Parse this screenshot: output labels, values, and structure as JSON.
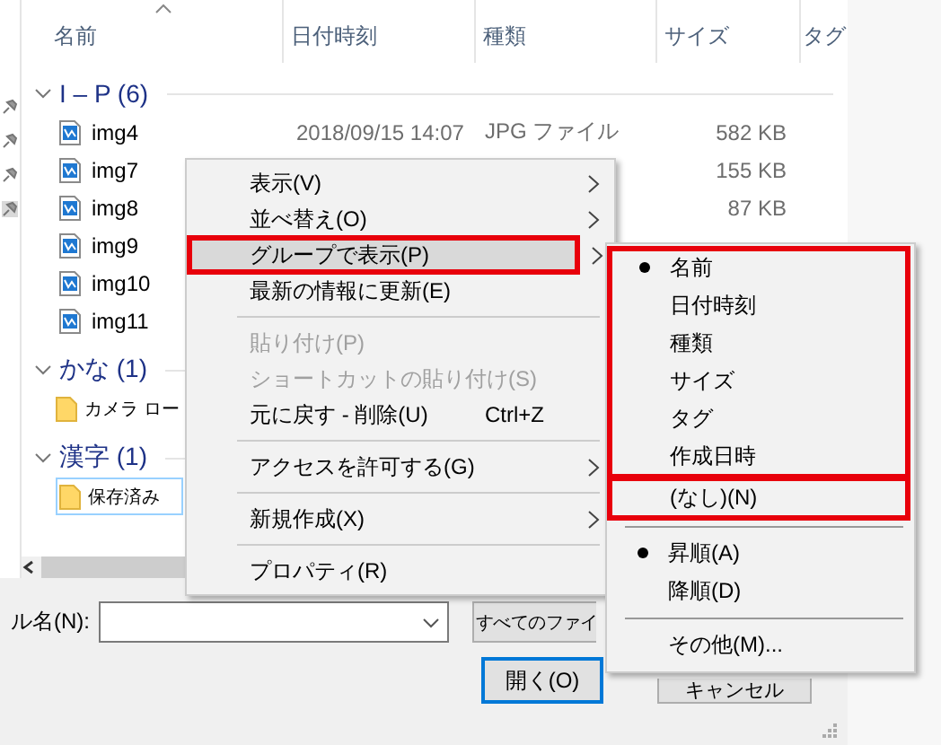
{
  "columns": [
    {
      "label": "名前",
      "sorted": true
    },
    {
      "label": "日付時刻",
      "sorted": false
    },
    {
      "label": "種類",
      "sorted": false
    },
    {
      "label": "サイズ",
      "sorted": false
    },
    {
      "label": "タグ",
      "sorted": false
    }
  ],
  "groups": [
    {
      "label": "I – P (6)",
      "expanded": true,
      "rows": [
        {
          "kind": "image",
          "name": "img4",
          "date": "2018/09/15 14:07",
          "type": "JPG ファイル",
          "size": "582 KB",
          "selected": false
        },
        {
          "kind": "image",
          "name": "img7",
          "size": "155 KB",
          "selected": false
        },
        {
          "kind": "image",
          "name": "img8",
          "size": "87 KB",
          "selected": false
        },
        {
          "kind": "image",
          "name": "img9",
          "selected": false
        },
        {
          "kind": "image",
          "name": "img10",
          "selected": false
        },
        {
          "kind": "image",
          "name": "img11",
          "selected": false
        }
      ]
    },
    {
      "label": "かな (1)",
      "expanded": true,
      "rows": [
        {
          "kind": "folder",
          "name": "カメラ ロー",
          "selected": false
        }
      ]
    },
    {
      "label": "漢字 (1)",
      "expanded": true,
      "rows": [
        {
          "kind": "folder",
          "name": "保存済み",
          "selected": true
        }
      ]
    }
  ],
  "file_name": {
    "label": "ル名(N):"
  },
  "file_type": {
    "value": "すべてのファイ"
  },
  "buttons": [
    {
      "label": "開く(O)",
      "default": true
    },
    {
      "label": "キャンセル",
      "default": false
    }
  ],
  "context_menu": [
    {
      "kind": "item",
      "label": "表示(V)",
      "submenu": true,
      "disabled": false,
      "selected": false,
      "outlined": false
    },
    {
      "kind": "item",
      "label": "並べ替え(O)",
      "submenu": true,
      "disabled": false,
      "selected": false,
      "outlined": false
    },
    {
      "kind": "item",
      "label": "グループで表示(P)",
      "submenu": true,
      "disabled": false,
      "selected": true,
      "outlined": true
    },
    {
      "kind": "item",
      "label": "最新の情報に更新(E)",
      "submenu": false,
      "disabled": false,
      "selected": false,
      "outlined": false
    },
    {
      "kind": "separator"
    },
    {
      "kind": "item",
      "label": "貼り付け(P)",
      "submenu": false,
      "disabled": true,
      "selected": false,
      "outlined": false
    },
    {
      "kind": "item",
      "label": "ショートカットの貼り付け(S)",
      "submenu": false,
      "disabled": true,
      "selected": false,
      "outlined": false
    },
    {
      "kind": "item",
      "label": "元に戻す - 削除(U)",
      "shortcut": "Ctrl+Z",
      "submenu": false,
      "disabled": false,
      "selected": false,
      "outlined": false
    },
    {
      "kind": "separator"
    },
    {
      "kind": "item",
      "label": "アクセスを許可する(G)",
      "submenu": true,
      "disabled": false,
      "selected": false,
      "outlined": false
    },
    {
      "kind": "separator"
    },
    {
      "kind": "item",
      "label": "新規作成(X)",
      "submenu": true,
      "disabled": false,
      "selected": false,
      "outlined": false
    },
    {
      "kind": "separator"
    },
    {
      "kind": "item",
      "label": "プロパティ(R)",
      "submenu": false,
      "disabled": false,
      "selected": false,
      "outlined": false
    }
  ],
  "submenu": [
    {
      "divider_before": false,
      "outlined": true,
      "items": [
        {
          "label": "名前",
          "checked": true
        },
        {
          "label": "日付時刻",
          "checked": false
        },
        {
          "label": "種類",
          "checked": false
        },
        {
          "label": "サイズ",
          "checked": false
        },
        {
          "label": "タグ",
          "checked": false
        },
        {
          "label": "作成日時",
          "checked": false
        }
      ]
    },
    {
      "divider_before": false,
      "outlined": true,
      "items": [
        {
          "label": "(なし)(N)",
          "checked": false
        }
      ]
    },
    {
      "divider_before": true,
      "outlined": false,
      "items": [
        {
          "label": "昇順(A)",
          "checked": true
        },
        {
          "label": "降順(D)",
          "checked": false
        }
      ]
    },
    {
      "divider_before": true,
      "outlined": false,
      "items": [
        {
          "label": "その他(M)...",
          "checked": false
        }
      ]
    }
  ]
}
